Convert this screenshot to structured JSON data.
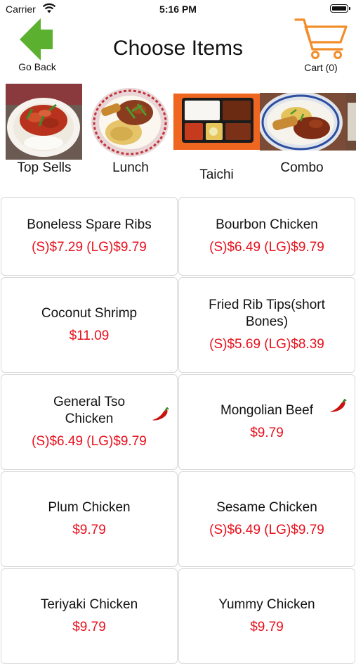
{
  "status_bar": {
    "carrier": "Carrier",
    "time": "5:16 PM"
  },
  "nav": {
    "back_label": "Go Back",
    "title": "Choose Items",
    "cart_label": "Cart (0)",
    "back_icon_color": "#5cb030",
    "cart_icon_color": "#f28d2b"
  },
  "categories": [
    {
      "label": "Top Sells",
      "image": "plate-of-spicy-chicken-over-rice"
    },
    {
      "label": "Lunch",
      "image": "plate-of-chicken-and-fried-rice"
    },
    {
      "label": "Taichi",
      "image": "bento-box-with-rice-and-sides"
    },
    {
      "label": "Combo",
      "image": "combo-plate-with-egg-roll"
    }
  ],
  "menu_items": [
    {
      "name": "Boneless Spare Ribs",
      "price": "(S)$7.29 (LG)$9.79",
      "spicy": false
    },
    {
      "name": "Bourbon Chicken",
      "price": "(S)$6.49 (LG)$9.79",
      "spicy": false
    },
    {
      "name": "Coconut Shrimp",
      "price": "$11.09",
      "spicy": false
    },
    {
      "name": "Fried Rib Tips(short Bones)",
      "price": "(S)$5.69 (LG)$8.39",
      "spicy": false
    },
    {
      "name": "General Tso Chicken",
      "price": "(S)$6.49 (LG)$9.79",
      "spicy": true
    },
    {
      "name": "Mongolian Beef",
      "price": "$9.79",
      "spicy": true
    },
    {
      "name": "Plum Chicken",
      "price": "$9.79",
      "spicy": false
    },
    {
      "name": "Sesame Chicken",
      "price": "(S)$6.49 (LG)$9.79",
      "spicy": false
    },
    {
      "name": "Teriyaki Chicken",
      "price": "$9.79",
      "spicy": false
    },
    {
      "name": "Yummy Chicken",
      "price": "$9.79",
      "spicy": false
    }
  ],
  "colors": {
    "price": "#e8101c",
    "border": "#d9d9d9",
    "spicy_icon": "#c9140f"
  }
}
